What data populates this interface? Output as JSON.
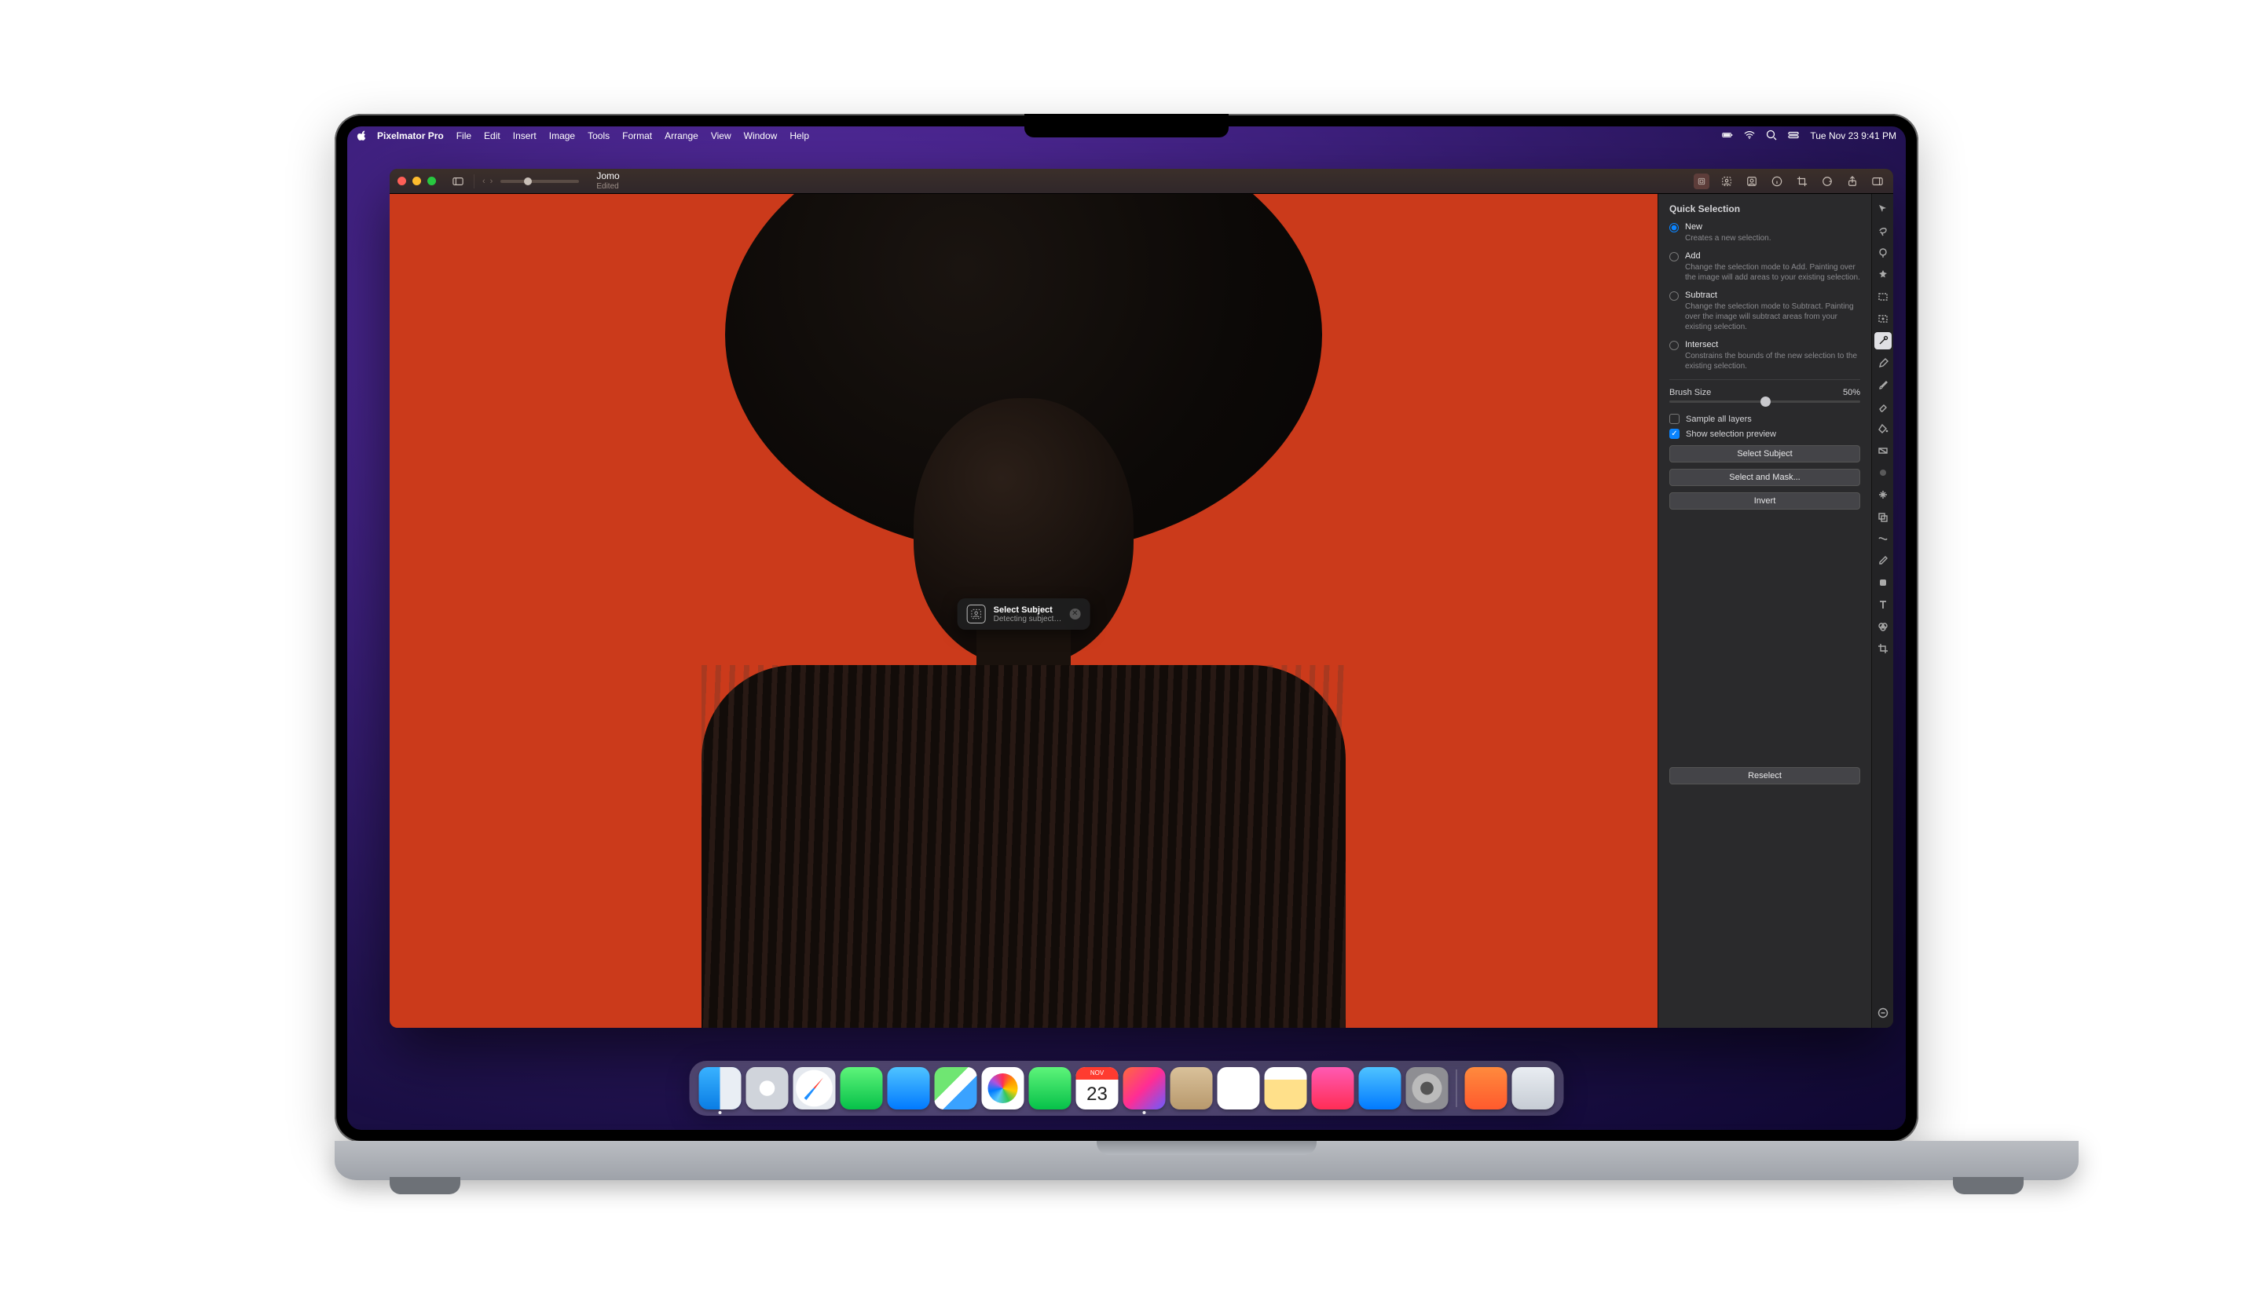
{
  "menubar": {
    "app_name": "Pixelmator Pro",
    "items": [
      "File",
      "Edit",
      "Insert",
      "Image",
      "Tools",
      "Format",
      "Arrange",
      "View",
      "Window",
      "Help"
    ],
    "clock": "Tue Nov 23  9:41 PM"
  },
  "window": {
    "title": "Jomo",
    "status": "Edited"
  },
  "hud": {
    "title": "Select Subject",
    "subtitle": "Detecting subject…"
  },
  "panel": {
    "title": "Quick Selection",
    "modes": [
      {
        "label": "New",
        "desc": "Creates a new selection.",
        "selected": true
      },
      {
        "label": "Add",
        "desc": "Change the selection mode to Add. Painting over the image will add areas to your existing selection.",
        "selected": false
      },
      {
        "label": "Subtract",
        "desc": "Change the selection mode to Subtract. Painting over the image will subtract areas from your existing selection.",
        "selected": false
      },
      {
        "label": "Intersect",
        "desc": "Constrains the bounds of the new selection to the existing selection.",
        "selected": false
      }
    ],
    "brush_label": "Brush Size",
    "brush_value": "50%",
    "brush_pct": 50,
    "sample_all_label": "Sample all layers",
    "sample_all": false,
    "preview_label": "Show selection preview",
    "preview": true,
    "buttons": {
      "select_subject": "Select Subject",
      "select_and_mask": "Select and Mask...",
      "invert": "Invert",
      "reselect": "Reselect"
    }
  },
  "calendar": {
    "month": "NOV",
    "day": "23"
  },
  "dock": [
    {
      "name": "finder",
      "running": true
    },
    {
      "name": "launchpad"
    },
    {
      "name": "safari"
    },
    {
      "name": "messages"
    },
    {
      "name": "mail"
    },
    {
      "name": "maps"
    },
    {
      "name": "photos"
    },
    {
      "name": "facetime"
    },
    {
      "name": "calendar"
    },
    {
      "name": "pixelmator",
      "running": true
    },
    {
      "name": "contacts"
    },
    {
      "name": "reminders"
    },
    {
      "name": "notes"
    },
    {
      "name": "music"
    },
    {
      "name": "appstore"
    },
    {
      "name": "prefs"
    }
  ]
}
